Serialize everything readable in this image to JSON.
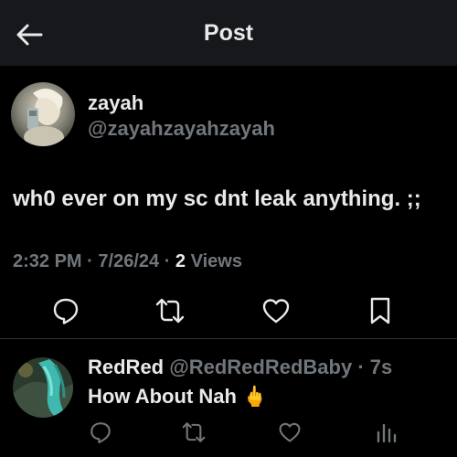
{
  "header": {
    "back_icon": "arrow-left-icon",
    "title": "Post"
  },
  "post": {
    "author": {
      "name": "zayah",
      "handle": "@zayahzayahzayah",
      "avatar_icon": "avatar-image"
    },
    "text": "wh0 ever on my sc dnt leak anything. ;;",
    "time": "2:32 PM",
    "date": "7/26/24",
    "views_count": "2",
    "views_label": "Views",
    "separator": "·",
    "actions": [
      {
        "name": "reply",
        "icon": "comment-icon"
      },
      {
        "name": "repost",
        "icon": "repost-icon"
      },
      {
        "name": "like",
        "icon": "heart-icon"
      },
      {
        "name": "bookmark",
        "icon": "bookmark-icon"
      }
    ]
  },
  "reply": {
    "author": {
      "name": "RedRed",
      "handle": "@RedRedRedBaby",
      "avatar_icon": "avatar-image"
    },
    "separator": "·",
    "time": "7s",
    "text": "How About Nah",
    "emoji": "🖕",
    "actions": [
      {
        "name": "reply",
        "icon": "comment-icon"
      },
      {
        "name": "repost",
        "icon": "repost-icon"
      },
      {
        "name": "like",
        "icon": "heart-icon"
      },
      {
        "name": "views",
        "icon": "bar-chart-icon"
      }
    ]
  },
  "colors": {
    "background": "#000000",
    "header_bg": "#16181c",
    "primary_text": "#e7e9ea",
    "secondary_text": "#71767b",
    "divider": "#2f3336"
  }
}
